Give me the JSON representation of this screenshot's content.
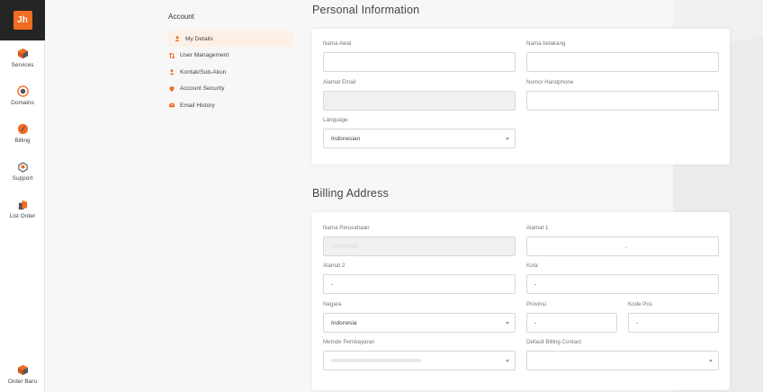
{
  "sidebar": {
    "logo": "Jh",
    "items": [
      {
        "label": "Services",
        "icon": "box-icon"
      },
      {
        "label": "Domains",
        "icon": "globe-icon"
      },
      {
        "label": "Billing",
        "icon": "coin-icon"
      },
      {
        "label": "Support",
        "icon": "lifebuoy-icon"
      },
      {
        "label": "List Order",
        "icon": "cart-icon"
      }
    ],
    "bottom": {
      "label": "Order Baru",
      "icon": "box-icon"
    }
  },
  "account_nav": {
    "title": "Account",
    "items": [
      {
        "label": "My Details",
        "icon": "user-icon",
        "active": true
      },
      {
        "label": "User Management",
        "icon": "arrows-icon"
      },
      {
        "label": "Kontak/Sub-Akun",
        "icon": "user-icon"
      },
      {
        "label": "Account Security",
        "icon": "shield-icon"
      },
      {
        "label": "Email History",
        "icon": "mail-icon"
      }
    ]
  },
  "personal": {
    "title": "Personal Information",
    "first_name_label": "Nama Awal",
    "last_name_label": "Nama belakang",
    "email_label": "Alamat Email",
    "phone_label": "Nomor Handphone",
    "language_label": "Language",
    "language_value": "Indonesian"
  },
  "billing": {
    "title": "Billing Address",
    "company_label": "Nama Perusahaan",
    "address1_label": "Alamat 1",
    "address1_value": ".",
    "address2_label": "Alamat 2",
    "address2_value": "-",
    "city_label": "Kota",
    "city_value": "-",
    "country_label": "Negara",
    "country_value": "Indonesia",
    "province_label": "Provinsi",
    "province_value": "-",
    "postcode_label": "Kode Pos",
    "postcode_value": "-",
    "payment_label": "Metode Pembayaran",
    "billing_contact_label": "Default Billing Contact"
  },
  "colors": {
    "accent": "#f26c22",
    "rail_top": "#242424"
  }
}
